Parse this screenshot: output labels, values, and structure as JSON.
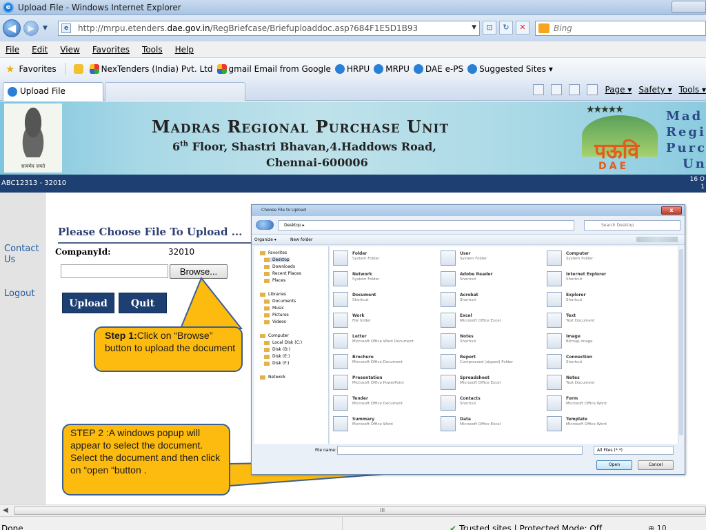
{
  "window": {
    "title": "Upload File - Windows Internet Explorer"
  },
  "address": {
    "url_prefix": "http://mrpu.etenders.",
    "url_domain": "dae.gov.in",
    "url_suffix": "/RegBriefcase/Briefuploaddoc.asp?684F1E5D1B93",
    "search_placeholder": "Bing"
  },
  "menu": [
    "File",
    "Edit",
    "View",
    "Favorites",
    "Tools",
    "Help"
  ],
  "favorites": {
    "label": "Favorites",
    "items": [
      "NexTenders (India) Pvt. Ltd",
      "gmail Email from Google",
      "HRPU",
      "MRPU",
      "DAE e-PS",
      "Suggested Sites ▾"
    ]
  },
  "tab": {
    "label": "Upload File"
  },
  "command_bar": {
    "page": "Page ▾",
    "safety": "Safety ▾",
    "tools": "Tools ▾"
  },
  "banner": {
    "title": "Madras Regional Purchase Unit",
    "address_prefix": "6",
    "address_sup": "th",
    "address_rest": " Floor, Shastri Bhavan,4.Haddows Road,",
    "city": "Chennai-600006",
    "side_lines": [
      "Mad",
      "Regi",
      "Purc",
      "Un"
    ],
    "logo_hindi": "पऊवि",
    "logo_dae": "DAE"
  },
  "strip": {
    "user": "ABC12313 - 32010",
    "date_line1": "16 O",
    "date_line2": "1"
  },
  "sidebar": {
    "contact": "Contact Us",
    "logout": "Logout"
  },
  "upload": {
    "title": "Please Choose File To Upload ...",
    "company_label": "CompanyId:",
    "company_value": "32010",
    "browse": "Browse...",
    "upload": "Upload",
    "quit": "Quit"
  },
  "callouts": {
    "step1_bold": "Step 1:",
    "step1_text": "Click on “Browse” button to upload the document",
    "step2_text": "STEP 2 :A windows popup will appear to select the document.  Select the document and then click on “open “button ."
  },
  "statusbar": {
    "done": "Done",
    "zone": "Trusted sites | Protected Mode: Off",
    "zoom": "⊕ 10"
  }
}
